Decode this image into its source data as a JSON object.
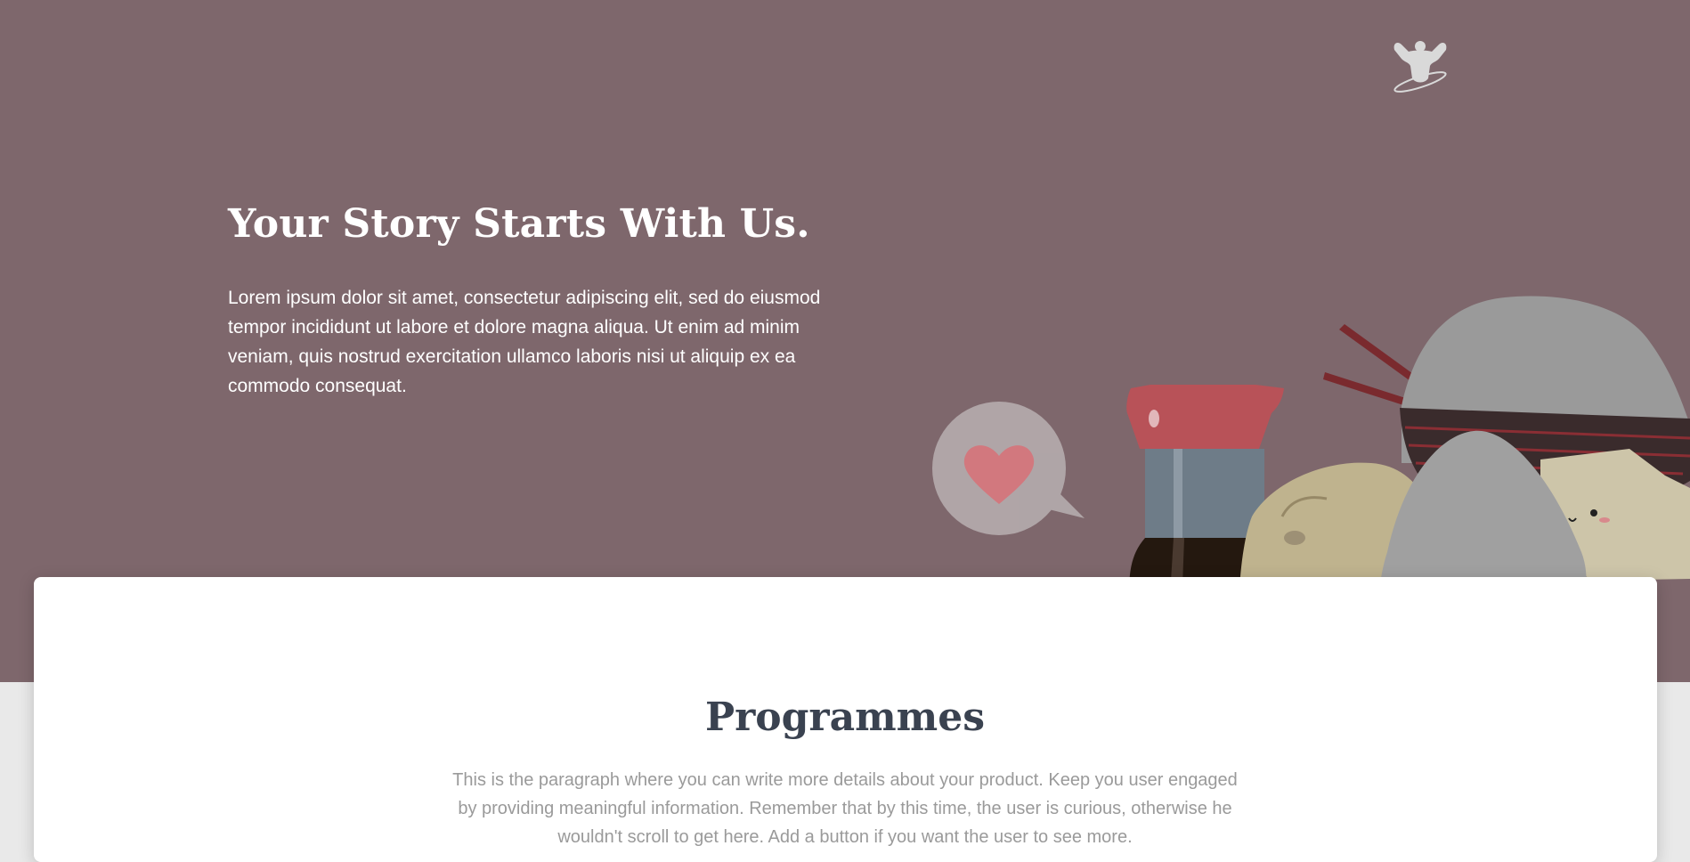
{
  "hero": {
    "logo_icon": "bodybuilder-logo-icon",
    "title": "Your Story Starts With Us.",
    "text": "Lorem ipsum dolor sit amet, consectetur adipiscing elit, sed do eiusmod tempor incididunt ut labore et dolore magna aliqua. Ut enim ad minim veniam, quis nostrud exercitation ullamco laboris nisi ut aliquip ex ea commodo consequat.",
    "background_color": "#7e676c",
    "illustration": "japanese-food-illustration"
  },
  "section": {
    "title": "Programmes",
    "text": "This is the paragraph where you can write more details about your product. Keep you user engaged by providing meaningful information. Remember that by this time, the user is curious, otherwise he wouldn't scroll to get here. Add a button if you want the user to see more."
  },
  "colors": {
    "heading": "#3a4250",
    "body_text": "#9a9a9a",
    "card": "#ffffff"
  }
}
